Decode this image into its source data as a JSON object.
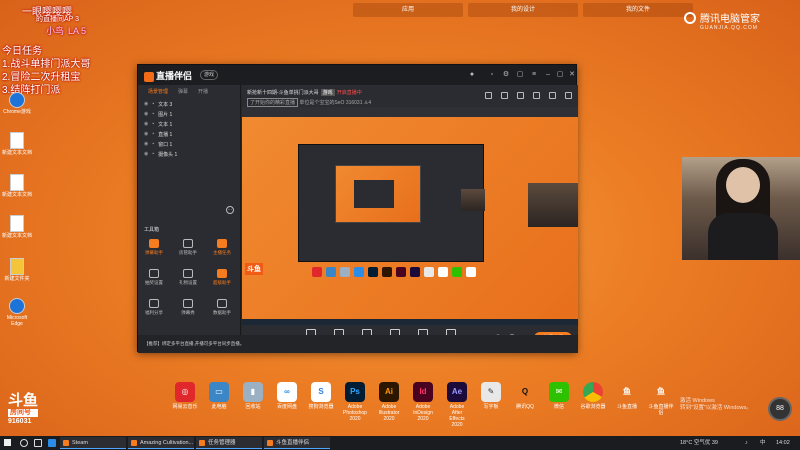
{
  "desktop": {
    "top_tabs": [
      "应用",
      "我的设计",
      "我的文件"
    ],
    "brand": {
      "name": "腾讯电脑管家",
      "sub": "GUANJIA.QQ.COM"
    },
    "overlay": {
      "top_a": "一眼嘤嘤嘤",
      "top_b": "的直播间AP 3",
      "pink_a": "小鸟",
      "pink_b": "LA 5",
      "today": "今日任务",
      "task1": "1.战斗单排门派大哥",
      "task2": "2.冒险二次升租宝",
      "task3": "3.结阵打门派"
    },
    "icons": [
      {
        "label": "Chrome游戏",
        "kind": "e"
      },
      {
        "label": "新建文本文档",
        "kind": "w"
      },
      {
        "label": "新建文本文档",
        "kind": "w"
      },
      {
        "label": "新建文本文档",
        "kind": "w"
      },
      {
        "label": "新建文件夹",
        "kind": "y"
      },
      {
        "label": "Microsoft Edge",
        "kind": "e"
      }
    ]
  },
  "obs": {
    "app_name": "直播伴侣",
    "badge": "游戏",
    "side_tabs": [
      "场景管理",
      "弹幕",
      "开播"
    ],
    "sources": [
      "文本 3",
      "图片 1",
      "文本 1",
      "直播 1",
      "窗口 1",
      "摄像头 1"
    ],
    "tools_title": "工具箱",
    "tools": [
      {
        "label": "弹幕助手",
        "hl": true
      },
      {
        "label": "房管助手",
        "hl": false
      },
      {
        "label": "主播任务",
        "hl": true
      },
      {
        "label": "抽奖设置",
        "hl": false
      },
      {
        "label": "礼物设置",
        "hl": false
      },
      {
        "label": "超级助手",
        "hl": true
      },
      {
        "label": "福利分享",
        "hl": false
      },
      {
        "label": "弹幕秀",
        "hl": false
      },
      {
        "label": "数据助手",
        "hl": false
      }
    ],
    "title": "新抢新十四期-斗鱼单挑门派大哥",
    "title_tag": "游戏",
    "title_red": "开启直播中",
    "line2_tag": "了开始你的精彩直播",
    "line2": "单位是个宝宝的SeO",
    "room_num": "316031",
    "viewers": "4",
    "preview_logo": "斗鱼",
    "bottom": [
      "直播屏幕",
      "摄像头",
      "手机投屏",
      "多媒体",
      "麦克风",
      "扬声器"
    ],
    "live_btn": "关闭直播",
    "notice": "【推荐】绑定多平台直播,开播可多平台同步直播。"
  },
  "dock": [
    {
      "label": "网易云音乐",
      "color": "#e0272b",
      "glyph": "◎"
    },
    {
      "label": "此电脑",
      "color": "#3b86c6",
      "glyph": "▭"
    },
    {
      "label": "回收站",
      "color": "#9bb0c2",
      "glyph": "▮"
    },
    {
      "label": "百度网盘",
      "color": "#2b8de8",
      "glyph": "∞"
    },
    {
      "label": "搜狗浏览器",
      "color": "#2c7ee0",
      "glyph": "S"
    },
    {
      "label": "Adobe Photoshop 2020",
      "color": "#001d34",
      "glyph": "Ps"
    },
    {
      "label": "Adobe Illustrator 2020",
      "color": "#2d1600",
      "glyph": "Ai"
    },
    {
      "label": "Adobe InDesign 2020",
      "color": "#49021f",
      "glyph": "Id"
    },
    {
      "label": "Adobe After Effects 2020",
      "color": "#1a0b3b",
      "glyph": "Ae"
    },
    {
      "label": "写字板",
      "color": "#e8e8e8",
      "glyph": "✎"
    },
    {
      "label": "腾讯QQ",
      "color": "#ffffff",
      "glyph": "Q"
    },
    {
      "label": "微信",
      "color": "#2dc100",
      "glyph": "✉"
    },
    {
      "label": "谷歌浏览器",
      "color": "#ffffff",
      "glyph": "●"
    },
    {
      "label": "斗鱼直播",
      "color": "#ffffff",
      "glyph": "鱼"
    },
    {
      "label": "斗鱼直播伴侣",
      "color": "#ffffff",
      "glyph": "鱼"
    }
  ],
  "douyu": {
    "logo": "斗鱼",
    "tag": "房间号",
    "num": "916031"
  },
  "watermark": {
    "line1": "激活 Windows",
    "line2": "转到\"设置\"以激活 Windows。"
  },
  "meter": "88",
  "taskbar": {
    "tasks": [
      "Steam",
      "Amazing Cultivation...",
      "任务管理器",
      "斗鱼直播伴侣"
    ],
    "weather": "18°C 空气优 39",
    "lang": "中",
    "time": "14:02"
  }
}
